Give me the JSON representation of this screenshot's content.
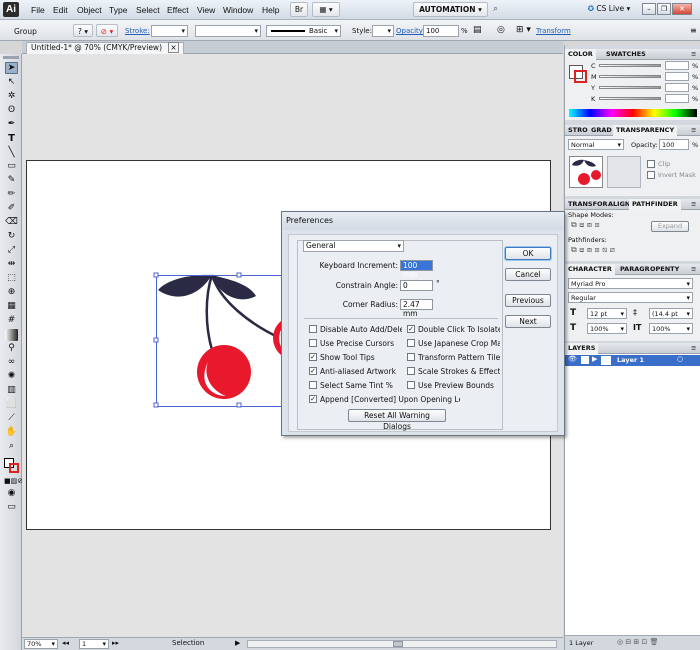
{
  "app": {
    "logo": "Ai"
  },
  "menubar": {
    "items": [
      "File",
      "Edit",
      "Object",
      "Type",
      "Select",
      "Effect",
      "View",
      "Window",
      "Help"
    ],
    "bridge": "Br",
    "workspace": "AUTOMATION",
    "cslive": "CS Live"
  },
  "control": {
    "selection": "Group",
    "stroke_label": "Stroke:",
    "brush_preset": "Basic",
    "style_label": "Style:",
    "opacity_label": "Opacity:",
    "opacity_value": "100",
    "percent": "%",
    "transform_label": "Transform"
  },
  "document": {
    "tab_title": "Untitled-1* @ 70% (CMYK/Preview)",
    "close": "×"
  },
  "status": {
    "zoom": "70%",
    "page": "1",
    "info": "Selection"
  },
  "dialog": {
    "title": "Preferences",
    "section": "General",
    "keyboard_increment_label": "Keyboard Increment:",
    "keyboard_increment_value": "100 mm",
    "constrain_angle_label": "Constrain Angle:",
    "constrain_angle_value": "0",
    "degree": "°",
    "corner_radius_label": "Corner Radius:",
    "corner_radius_value": "2.47 mm",
    "checkboxes": [
      {
        "label": "Disable Auto Add/Delete",
        "checked": false
      },
      {
        "label": "Double Click To Isolate",
        "checked": true
      },
      {
        "label": "Use Precise Cursors",
        "checked": false
      },
      {
        "label": "Use Japanese Crop Marks",
        "checked": false
      },
      {
        "label": "Show Tool Tips",
        "checked": true
      },
      {
        "label": "Transform Pattern Tiles",
        "checked": false
      },
      {
        "label": "Anti-aliased Artwork",
        "checked": true
      },
      {
        "label": "Scale Strokes & Effects",
        "checked": false
      },
      {
        "label": "Select Same Tint %",
        "checked": false
      },
      {
        "label": "Use Preview Bounds",
        "checked": false
      }
    ],
    "append_label": "Append [Converted] Upon Opening Legacy Files",
    "append_checked": true,
    "reset_button": "Reset All Warning Dialogs",
    "ok": "OK",
    "cancel": "Cancel",
    "previous": "Previous",
    "next": "Next"
  },
  "panels": {
    "color": {
      "tabs": [
        "COLOR",
        "SWATCHES"
      ],
      "channels": [
        "C",
        "M",
        "Y",
        "K"
      ],
      "percent": "%"
    },
    "transparency": {
      "tabs": [
        "STRO",
        "GRAD",
        "TRANSPARENCY"
      ],
      "mode": "Normal",
      "opacity_label": "Opacity:",
      "opacity_value": "100",
      "percent": "%",
      "clip": "Clip",
      "invert": "Invert Mask"
    },
    "pathfinder": {
      "tabs": [
        "TRANSFOR",
        "ALIGN",
        "PATHFINDER"
      ],
      "shape_modes": "Shape Modes:",
      "expand": "Expand",
      "pathfinders": "Pathfinders:"
    },
    "character": {
      "tabs": [
        "CHARACTER",
        "PARAGR",
        "OPENTY"
      ],
      "font": "Myriad Pro",
      "style": "Regular",
      "size": "12 pt",
      "leading": "(14.4 pt",
      "hscale": "100%",
      "vscale": "100%"
    },
    "layers": {
      "tab": "LAYERS",
      "layer": "Layer 1",
      "count": "1 Layer"
    }
  },
  "colors": {
    "cherry": "#e8192c",
    "leaf": "#2a2a45",
    "selection": "#4a64d8"
  }
}
